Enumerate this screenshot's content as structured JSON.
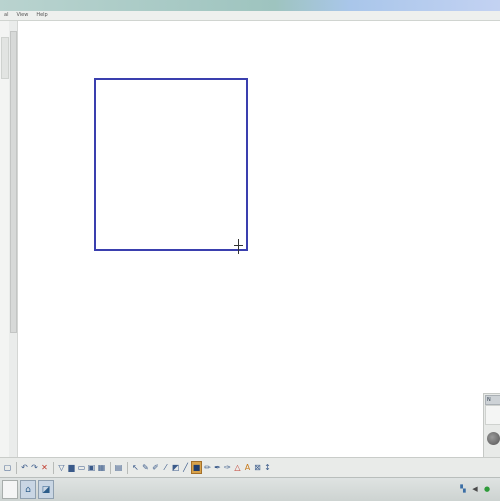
{
  "menu": {
    "items": [
      "al",
      "View",
      "Help"
    ]
  },
  "canvas": {
    "shape_color": "#3a3fae"
  },
  "float_widget": {
    "header_label": "N"
  },
  "toolbar": {
    "icons": [
      "frame-icon",
      "undo-icon",
      "redo-icon",
      "delete-icon",
      "screen-shade-icon",
      "monitor-icon",
      "fullscreen-icon",
      "screen-capture-icon",
      "table-icon",
      "keyboard-icon",
      "select-arrow-icon",
      "pen-icon",
      "creative-pen-icon",
      "highlighter-icon",
      "eraser-icon",
      "line-icon",
      "shape-icon",
      "fill-icon",
      "magic-pen-icon",
      "pen-tool-icon",
      "triangle-icon",
      "text-icon",
      "more-icon"
    ]
  },
  "taskbar": {
    "tray": [
      "network-icon",
      "volume-icon",
      "green-dot-icon"
    ]
  }
}
